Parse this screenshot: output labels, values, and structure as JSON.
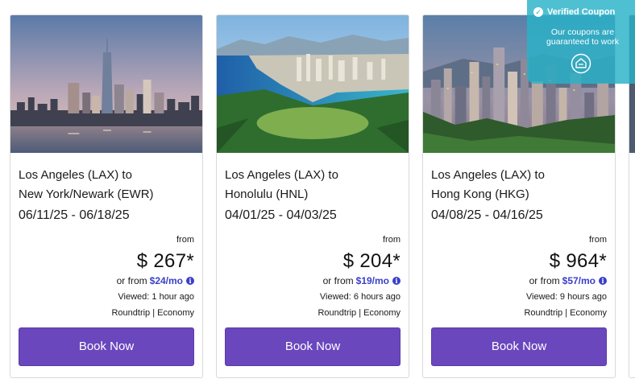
{
  "coupon": {
    "title": "Verified Coupon",
    "line1": "Our coupons are",
    "line2": "guaranteed to work"
  },
  "cards": [
    {
      "route_line1": "Los Angeles (LAX) to",
      "route_line2": "New York/Newark (EWR)",
      "dates": "06/11/25 - 06/18/25",
      "from": "from",
      "price": "$ 267*",
      "monthly_prefix": "or from",
      "monthly_amount": "$24/mo",
      "viewed": "Viewed: 1 hour ago",
      "trip": "Roundtrip | Economy",
      "button": "Book Now",
      "image": "new-york-skyline"
    },
    {
      "route_line1": "Los Angeles (LAX) to",
      "route_line2": "Honolulu (HNL)",
      "dates": "04/01/25 - 04/03/25",
      "from": "from",
      "price": "$ 204*",
      "monthly_prefix": "or from",
      "monthly_amount": "$19/mo",
      "viewed": "Viewed: 6 hours ago",
      "trip": "Roundtrip | Economy",
      "button": "Book Now",
      "image": "honolulu-coast"
    },
    {
      "route_line1": "Los Angeles (LAX) to",
      "route_line2": "Hong Kong (HKG)",
      "dates": "04/08/25 - 04/16/25",
      "from": "from",
      "price": "$ 964*",
      "monthly_prefix": "or from",
      "monthly_amount": "$57/mo",
      "viewed": "Viewed: 9 hours ago",
      "trip": "Roundtrip | Economy",
      "button": "Book Now",
      "image": "hong-kong-skyline"
    }
  ],
  "colors": {
    "button": "#6a47bd",
    "link": "#3a3fc8",
    "coupon": "#28b2c8"
  }
}
